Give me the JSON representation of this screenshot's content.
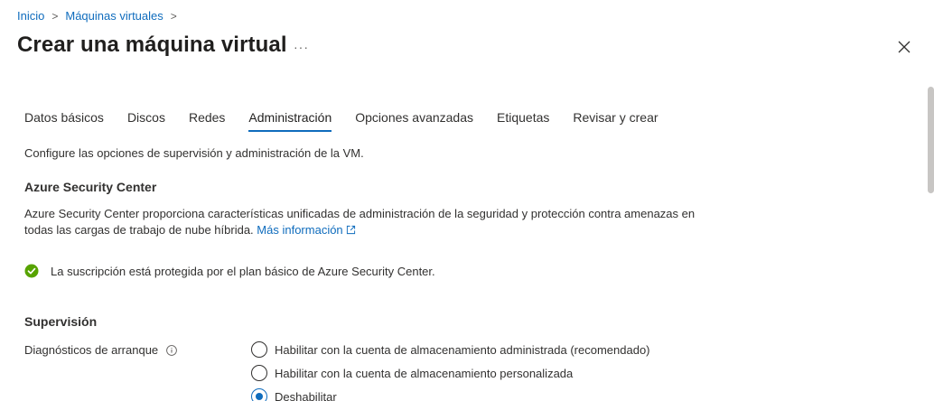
{
  "breadcrumb": {
    "items": [
      "Inicio",
      "Máquinas virtuales"
    ],
    "separator": ">"
  },
  "header": {
    "title": "Crear una máquina virtual",
    "more_label": "···"
  },
  "tabs": [
    {
      "label": "Datos básicos",
      "active": false
    },
    {
      "label": "Discos",
      "active": false
    },
    {
      "label": "Redes",
      "active": false
    },
    {
      "label": "Administración",
      "active": true
    },
    {
      "label": "Opciones avanzadas",
      "active": false
    },
    {
      "label": "Etiquetas",
      "active": false
    },
    {
      "label": "Revisar y crear",
      "active": false
    }
  ],
  "content": {
    "intro": "Configure las opciones de supervisión y administración de la VM.",
    "security_center": {
      "title": "Azure Security Center",
      "description": "Azure Security Center proporciona características unificadas de administración de la seguridad y protección contra amenazas en todas las cargas de trabajo de nube híbrida.",
      "learn_more": "Más información",
      "status": "La suscripción está protegida por el plan básico de Azure Security Center."
    },
    "monitoring": {
      "title": "Supervisión",
      "boot_diagnostics_label": "Diagnósticos de arranque",
      "options": [
        {
          "label": "Habilitar con la cuenta de almacenamiento administrada (recomendado)",
          "checked": false
        },
        {
          "label": "Habilitar con la cuenta de almacenamiento personalizada",
          "checked": false
        },
        {
          "label": "Deshabilitar",
          "checked": true
        }
      ]
    }
  },
  "colors": {
    "accent": "#0f6cbd",
    "success": "#57a300",
    "text": "#323130"
  },
  "icons": {
    "close": "close-icon",
    "external": "external-link-icon",
    "check": "check-circle-icon",
    "info": "info-icon"
  }
}
